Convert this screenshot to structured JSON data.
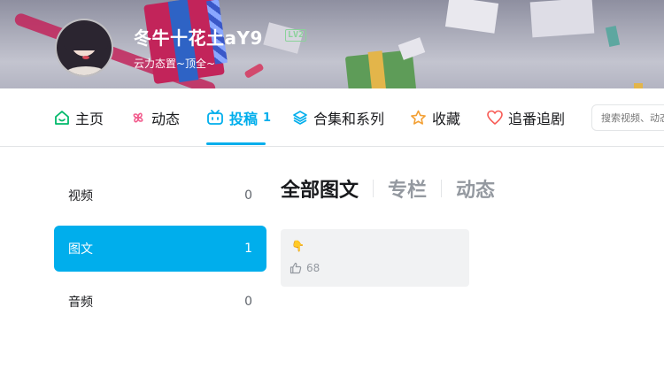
{
  "header": {
    "username": "冬牛十花土aY9",
    "level": "LV2",
    "signature": "云力态置~顶全~"
  },
  "nav": {
    "items": [
      {
        "label": "主页",
        "icon": "home-icon"
      },
      {
        "label": "动态",
        "icon": "pinwheel-icon"
      },
      {
        "label": "投稿",
        "icon": "tv-icon",
        "count": "1",
        "active": true
      },
      {
        "label": "合集和系列",
        "icon": "layers-icon"
      },
      {
        "label": "收藏",
        "icon": "star-icon"
      },
      {
        "label": "追番追剧",
        "icon": "heart-icon"
      }
    ],
    "search_placeholder": "搜索视频、动态"
  },
  "sidebar": {
    "items": [
      {
        "label": "视频",
        "count": "0"
      },
      {
        "label": "图文",
        "count": "1",
        "active": true
      },
      {
        "label": "音频",
        "count": "0"
      }
    ]
  },
  "main": {
    "tabs": [
      "全部图文",
      "专栏",
      "动态"
    ],
    "card": {
      "emoji": "👇",
      "likes": "68"
    }
  },
  "colors": {
    "accent": "#00aeec",
    "text": "#18191c",
    "muted": "#9499a0"
  }
}
